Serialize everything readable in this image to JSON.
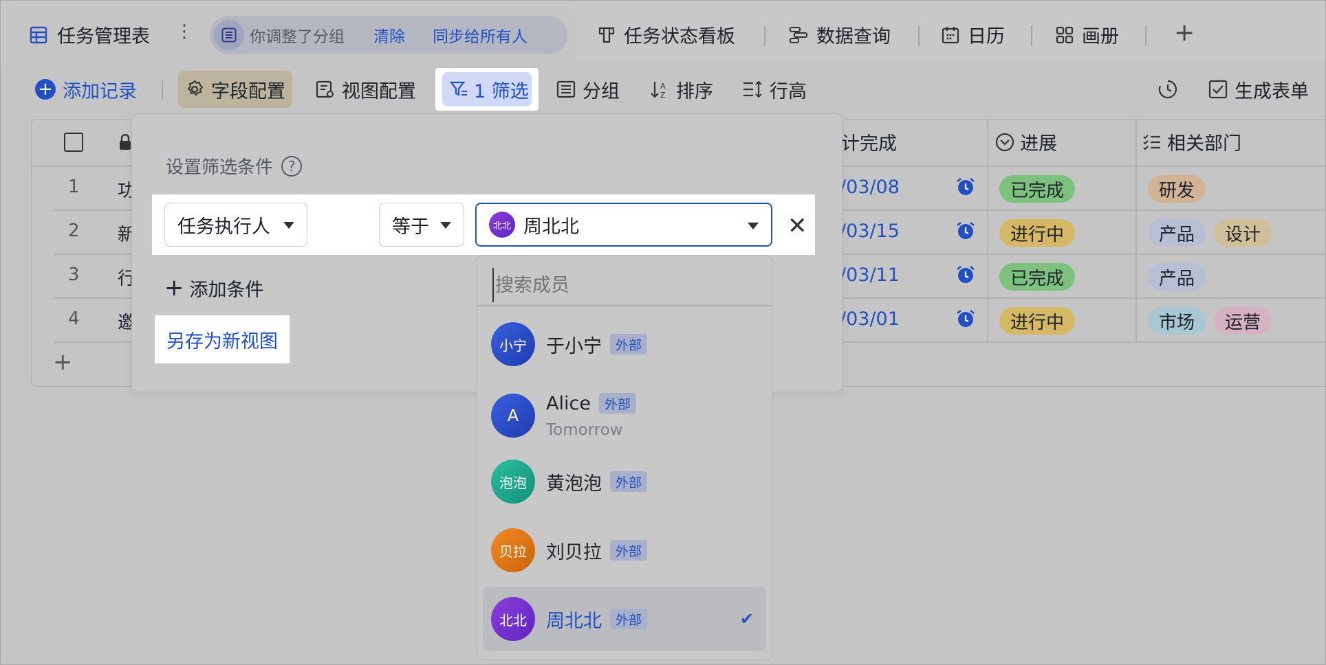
{
  "tabbar": {
    "active_title": "任务管理表",
    "notice": {
      "text": "你调整了分组",
      "clear_label": "清除",
      "sync_label": "同步给所有人"
    },
    "views": [
      {
        "label": "任务状态看板",
        "icon": "kanban-icon"
      },
      {
        "label": "数据查询",
        "icon": "gantt-icon"
      },
      {
        "label": "日历",
        "icon": "calendar-icon"
      },
      {
        "label": "画册",
        "icon": "gallery-icon"
      }
    ]
  },
  "toolbar": {
    "add_record": "添加记录",
    "field_config": "字段配置",
    "view_config": "视图配置",
    "filter": "1 筛选",
    "group": "分组",
    "sort": "排序",
    "row_height": "行高",
    "generate_form": "生成表单"
  },
  "table": {
    "headers": {
      "due": "计完成",
      "progress": "进展",
      "dept": "相关部门"
    },
    "rows": [
      {
        "num": "1",
        "text": "功",
        "date": "/03/08",
        "status": "已完成",
        "depts": [
          "研发"
        ]
      },
      {
        "num": "2",
        "text": "新",
        "date": "/03/15",
        "status": "进行中",
        "depts": [
          "产品",
          "设计"
        ]
      },
      {
        "num": "3",
        "text": "行",
        "date": "/03/11",
        "status": "已完成",
        "depts": [
          "产品"
        ]
      },
      {
        "num": "4",
        "text": "邀",
        "date": "/03/01",
        "status": "进行中",
        "depts": [
          "市场",
          "运营"
        ]
      }
    ]
  },
  "filter_popup": {
    "title": "设置筛选条件",
    "field": "任务执行人",
    "operator": "等于",
    "value": "周北北",
    "value_avatar": "北北",
    "add_condition": "添加条件",
    "save_as_view": "另存为新视图"
  },
  "member_dropdown": {
    "search_placeholder": "搜索成员",
    "external_label": "外部",
    "members": [
      {
        "name": "于小宁",
        "avatar": "小宁",
        "color": "#2f4fd0",
        "external": true
      },
      {
        "name": "Alice",
        "avatar": "A",
        "color": "#2f4fd0",
        "external": true,
        "subtitle": "Tomorrow"
      },
      {
        "name": "黄泡泡",
        "avatar": "泡泡",
        "color": "#1fa088",
        "external": true
      },
      {
        "name": "刘贝拉",
        "avatar": "贝拉",
        "color": "#e07a14",
        "external": true
      },
      {
        "name": "周北北",
        "avatar": "北北",
        "color": "#7a2fd6",
        "external": true,
        "selected": true
      }
    ]
  },
  "colors": {
    "accent": "#2150c4",
    "done": "#7cc27e",
    "in_progress": "#d4b865"
  }
}
